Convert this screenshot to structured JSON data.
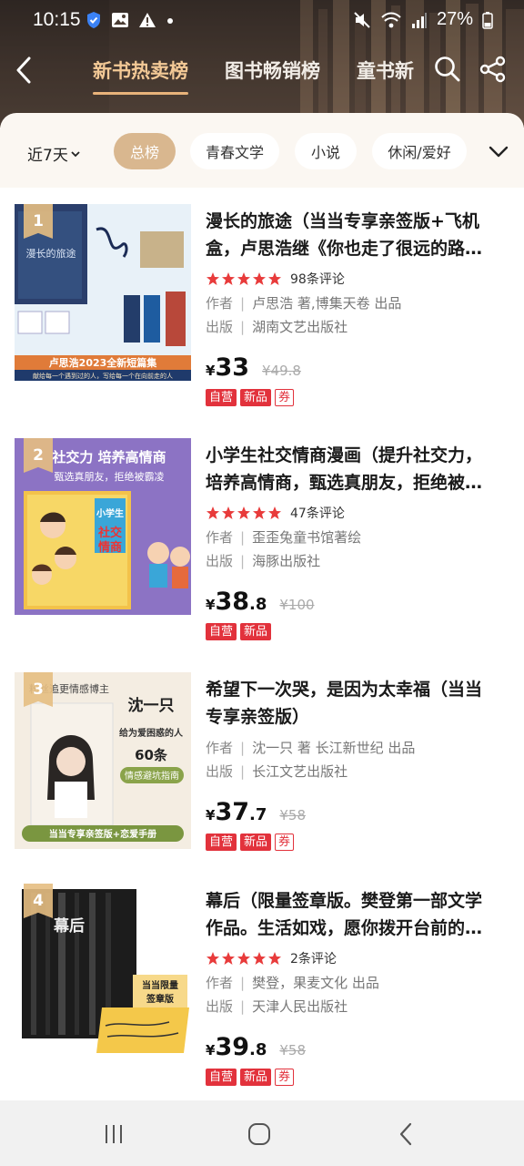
{
  "status_bar": {
    "time": "10:15",
    "battery": "27%"
  },
  "nav": {
    "tabs": [
      "新书热卖榜",
      "图书畅销榜",
      "童书新"
    ],
    "active_tab": 0
  },
  "filter": {
    "range": "近7天",
    "chips": [
      "总榜",
      "青春文学",
      "小说",
      "休闲/爱好"
    ],
    "active_chip": 0
  },
  "colors": {
    "accent": "#e8b27a",
    "chip_active": "#d9b78f",
    "tag_red": "#e2323c",
    "header_bg": "#3e332c"
  },
  "books": [
    {
      "rank": "1",
      "title": "漫长的旅途（当当专享亲签版+飞机盒，卢思浩继《你也走了很远的路…",
      "rating_stars": 5,
      "reviews": "98条评论",
      "author_label": "作者",
      "author": "卢思浩 著,博集天卷 出品",
      "publisher_label": "出版",
      "publisher": "湖南文艺出版社",
      "yen": "¥",
      "price_int": "33",
      "price_dec": "",
      "orig_price": "¥49.8",
      "tags": [
        {
          "text": "自营",
          "style": "red"
        },
        {
          "text": "新品",
          "style": "red"
        },
        {
          "text": "券",
          "style": "outline"
        }
      ],
      "cover_text": {
        "line1": "漫长的旅途",
        "banner": "卢思浩2023全新短篇集",
        "sub": "献给每一个遇到过的人，写给每一个在向前走的人"
      }
    },
    {
      "rank": "2",
      "title": "小学生社交情商漫画（提升社交力，培养高情商，甄选真朋友，拒绝被…",
      "rating_stars": 5,
      "reviews": "47条评论",
      "author_label": "作者",
      "author": "歪歪兔童书馆著绘",
      "publisher_label": "出版",
      "publisher": "海豚出版社",
      "yen": "¥",
      "price_int": "38",
      "price_dec": ".8",
      "orig_price": "¥100",
      "tags": [
        {
          "text": "自营",
          "style": "red"
        },
        {
          "text": "新品",
          "style": "red"
        }
      ],
      "cover_text": {
        "line1": "社交力 培养高情商",
        "line2": "甄选真朋友，拒绝被霸凌",
        "book": "小学生社交情商漫画"
      }
    },
    {
      "rank": "3",
      "title": "希望下一次哭，是因为太幸福（当当专享亲签版）",
      "rating_stars": 0,
      "reviews": "",
      "author_label": "作者",
      "author": "沈一只 著 长江新世纪 出品",
      "publisher_label": "出版",
      "publisher": "长江文艺出版社",
      "yen": "¥",
      "price_int": "37",
      "price_dec": ".7",
      "orig_price": "¥58",
      "tags": [
        {
          "text": "自营",
          "style": "red"
        },
        {
          "text": "新品",
          "style": "red"
        },
        {
          "text": "券",
          "style": "outline"
        }
      ],
      "cover_text": {
        "line1": "粉丝追更情感博主",
        "name": "沈一只",
        "line2": "给为爱困惑的人",
        "line3": "60条",
        "line4": "情感避坑指南",
        "banner": "当当专享亲签版+恋爱手册"
      }
    },
    {
      "rank": "4",
      "title": "幕后（限量签章版。樊登第一部文学作品。生活如戏，愿你拨开台前的…",
      "rating_stars": 5,
      "reviews": "2条评论",
      "author_label": "作者",
      "author": "樊登，果麦文化 出品",
      "publisher_label": "出版",
      "publisher": "天津人民出版社",
      "yen": "¥",
      "price_int": "39",
      "price_dec": ".8",
      "orig_price": "¥58",
      "tags": [
        {
          "text": "自营",
          "style": "red"
        },
        {
          "text": "新品",
          "style": "red"
        },
        {
          "text": "券",
          "style": "outline"
        }
      ],
      "cover_text": {
        "line1": "幕后",
        "badge1": "当当限量",
        "badge2": "签章版"
      }
    }
  ]
}
